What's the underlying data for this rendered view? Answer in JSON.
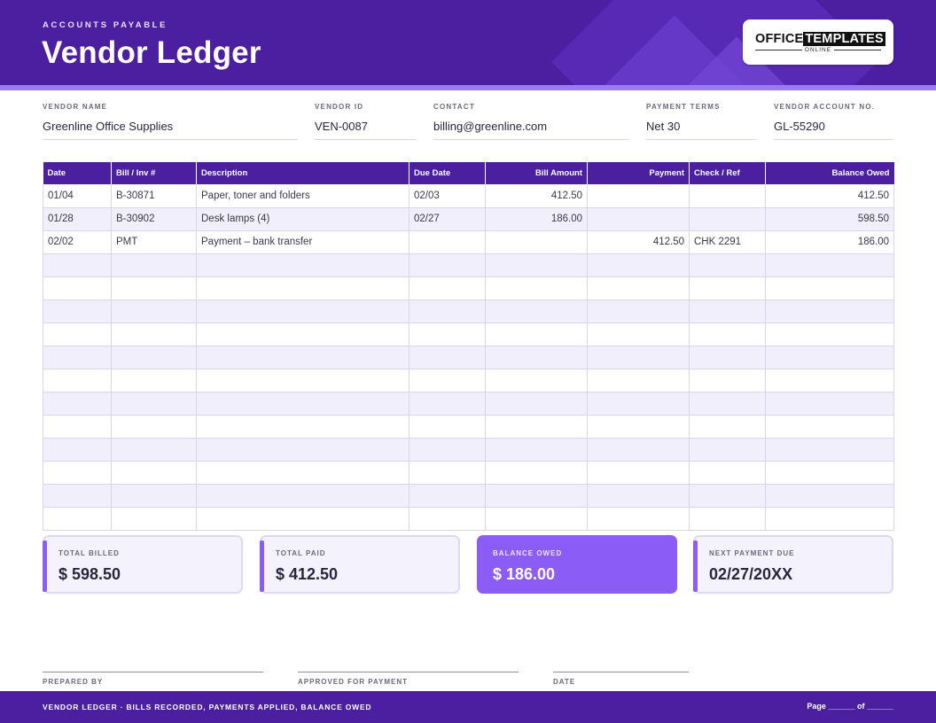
{
  "header": {
    "eyebrow": "ACCOUNTS PAYABLE",
    "title": "Vendor Ledger",
    "logo": {
      "part1": "OFFICE",
      "part2": "TEMPLATES",
      "part3": "ONLINE"
    }
  },
  "vendor_info": {
    "vendor_name": {
      "label": "VENDOR NAME",
      "value": "Greenline Office Supplies"
    },
    "vendor_id": {
      "label": "VENDOR ID",
      "value": "VEN-0087"
    },
    "contact": {
      "label": "CONTACT",
      "value": "billing@greenline.com"
    },
    "payment_terms": {
      "label": "PAYMENT TERMS",
      "value": "Net 30"
    },
    "account_no": {
      "label": "VENDOR ACCOUNT NO.",
      "value": "GL-55290"
    }
  },
  "table": {
    "columns": [
      "Date",
      "Bill / Inv #",
      "Description",
      "Due Date",
      "Bill Amount",
      "Payment",
      "Check / Ref",
      "Balance Owed"
    ],
    "rows": [
      [
        "01/04",
        "B-30871",
        "Paper, toner and folders",
        "02/03",
        "412.50",
        "",
        "",
        "412.50"
      ],
      [
        "01/28",
        "B-30902",
        "Desk lamps (4)",
        "02/27",
        "186.00",
        "",
        "",
        "598.50"
      ],
      [
        "02/02",
        "PMT",
        "Payment – bank transfer",
        "",
        "",
        "412.50",
        "CHK 2291",
        "186.00"
      ],
      [
        "",
        "",
        "",
        "",
        "",
        "",
        "",
        ""
      ],
      [
        "",
        "",
        "",
        "",
        "",
        "",
        "",
        ""
      ],
      [
        "",
        "",
        "",
        "",
        "",
        "",
        "",
        ""
      ],
      [
        "",
        "",
        "",
        "",
        "",
        "",
        "",
        ""
      ],
      [
        "",
        "",
        "",
        "",
        "",
        "",
        "",
        ""
      ],
      [
        "",
        "",
        "",
        "",
        "",
        "",
        "",
        ""
      ],
      [
        "",
        "",
        "",
        "",
        "",
        "",
        "",
        ""
      ],
      [
        "",
        "",
        "",
        "",
        "",
        "",
        "",
        ""
      ],
      [
        "",
        "",
        "",
        "",
        "",
        "",
        "",
        ""
      ],
      [
        "",
        "",
        "",
        "",
        "",
        "",
        "",
        ""
      ],
      [
        "",
        "",
        "",
        "",
        "",
        "",
        "",
        ""
      ],
      [
        "",
        "",
        "",
        "",
        "",
        "",
        "",
        ""
      ]
    ]
  },
  "summary": {
    "total_billed": {
      "label": "TOTAL BILLED",
      "value": "$ 598.50"
    },
    "total_paid": {
      "label": "TOTAL PAID",
      "value": "$ 412.50"
    },
    "balance_owed": {
      "label": "BALANCE OWED",
      "value": "$ 186.00"
    },
    "next_payment_due": {
      "label": "NEXT PAYMENT DUE",
      "value": "02/27/20XX"
    }
  },
  "signatures": {
    "prepared_by": "PREPARED BY",
    "approved": "APPROVED FOR PAYMENT",
    "date": "DATE"
  },
  "footer": {
    "left": "VENDOR LEDGER  ·  BILLS RECORDED, PAYMENTS APPLIED, BALANCE OWED",
    "right": "Page ______  of  ______"
  },
  "colors": {
    "brand_purple": "#4b1fa0",
    "accent_violet": "#8b5cf6",
    "row_alt": "#f1effb"
  }
}
